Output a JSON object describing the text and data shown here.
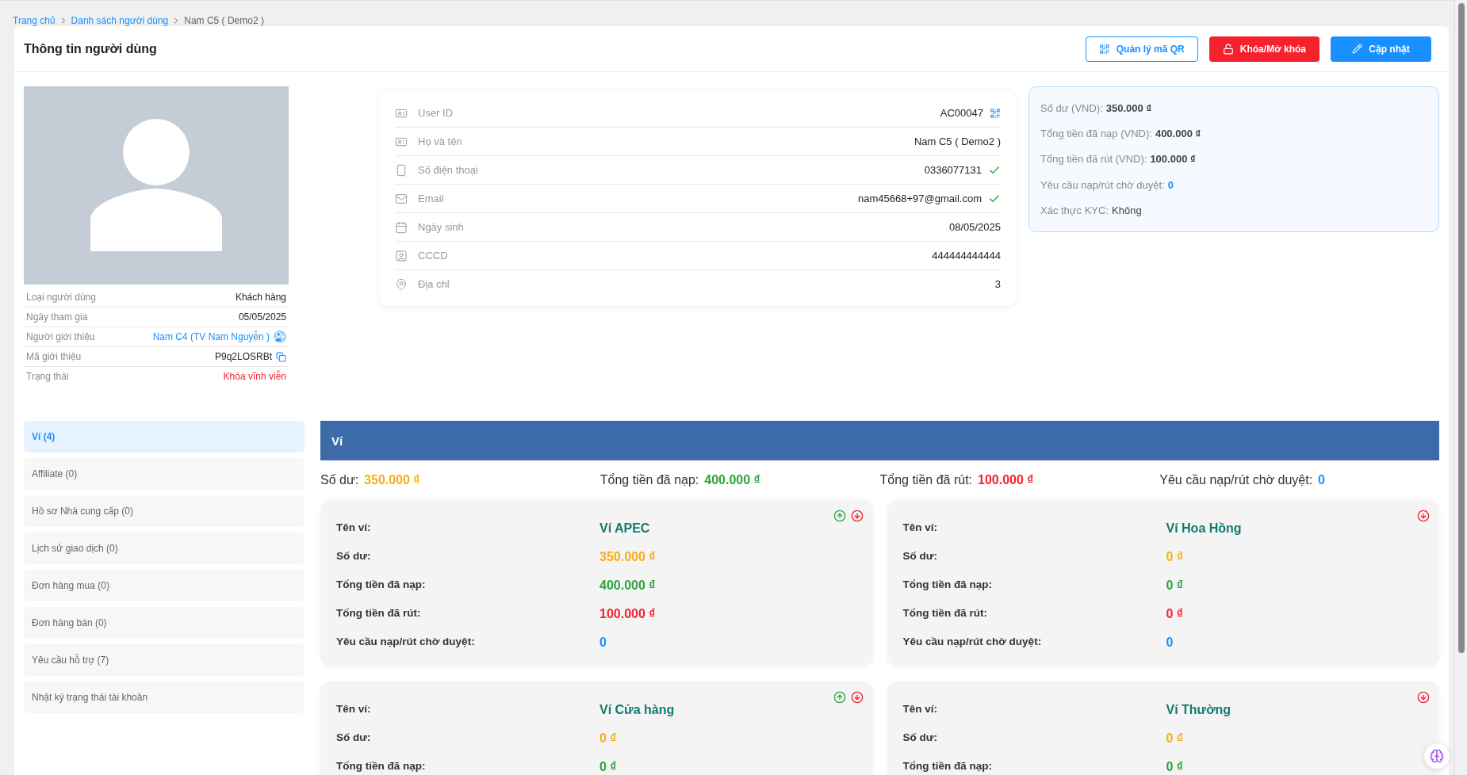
{
  "breadcrumb": [
    {
      "label": "Trang chủ",
      "current": false
    },
    {
      "label": "Danh sách người dùng",
      "current": false
    },
    {
      "label": "Nam C5 ( Demo2 )",
      "current": true
    }
  ],
  "header": {
    "title": "Thông tin người dùng",
    "buttons": [
      {
        "kind": "qr",
        "label": "Quản lý mã QR"
      },
      {
        "kind": "lock",
        "label": "Khóa/Mở khóa"
      },
      {
        "kind": "edit",
        "label": "Cập nhật"
      }
    ]
  },
  "profile": {
    "avatar": {
      "kind": "placeholder"
    },
    "rows": [
      {
        "label": "Loại người dùng",
        "value": "Khách hàng",
        "kind": "plain"
      },
      {
        "label": "Ngày tham gia",
        "value": "05/05/2025",
        "kind": "plain"
      },
      {
        "label": "Người giới thiệu",
        "value": "Nam C4 (TV Nam Nguyễn )",
        "kind": "link"
      },
      {
        "label": "Mã giới thiệu",
        "value": "P9q2LOSRBt",
        "kind": "code"
      },
      {
        "label": "Trạng thái",
        "value": "Khóa vĩnh viễn",
        "kind": "status"
      }
    ]
  },
  "details": [
    {
      "kind": "id",
      "label": "User ID",
      "value": "AC00047",
      "verified": false,
      "qr_code": true
    },
    {
      "kind": "id",
      "label": "Họ và tên",
      "value": "Nam C5 ( Demo2 )",
      "verified": false,
      "qr_code": false
    },
    {
      "kind": "phone",
      "label": "Số điện thoại",
      "value": "0336077131",
      "verified": true,
      "qr_code": false
    },
    {
      "kind": "mail",
      "label": "Email",
      "value": "nam45668+97@gmail.com",
      "verified": true,
      "qr_code": false
    },
    {
      "kind": "calendar",
      "label": "Ngày sinh",
      "value": "08/05/2025",
      "verified": false,
      "qr_code": false
    },
    {
      "kind": "card",
      "label": "CCCD",
      "value": "444444444444",
      "verified": false,
      "qr_code": false
    },
    {
      "kind": "pin",
      "label": "Địa chỉ",
      "value": "3",
      "verified": false,
      "qr_code": false
    }
  ],
  "summary": [
    {
      "label": "Số dư (VND):",
      "value": "350.000 ₫",
      "kind": "amount"
    },
    {
      "label": "Tổng tiền đã nạp (VND):",
      "value": "400.000 ₫",
      "kind": "amount"
    },
    {
      "label": "Tổng tiền đã rút (VND):",
      "value": "100.000 ₫",
      "kind": "amount"
    },
    {
      "label": "Yêu cầu nạp/rút chờ duyệt:",
      "value": "0",
      "kind": "count"
    },
    {
      "label": "Xác thực KYC:",
      "value": "Không",
      "kind": "text"
    }
  ],
  "tabs": [
    {
      "label": "Ví (4)",
      "selected": true
    },
    {
      "label": "Affiliate (0)",
      "selected": false
    },
    {
      "label": "Hồ sơ Nhà cung cấp (0)",
      "selected": false
    },
    {
      "label": "Lịch sử giao dịch (0)",
      "selected": false
    },
    {
      "label": "Đơn hàng mua (0)",
      "selected": false
    },
    {
      "label": "Đơn hàng bán (0)",
      "selected": false
    },
    {
      "label": "Yêu cầu hỗ trợ (7)",
      "selected": false
    },
    {
      "label": "Nhật ký trạng thái tài khoản",
      "selected": false
    }
  ],
  "wallet": {
    "title": "Ví",
    "totals": [
      {
        "label": "Số dư:",
        "value": "350.000 ₫",
        "kind": "balance"
      },
      {
        "label": "Tổng tiền đã nạp:",
        "value": "400.000 ₫",
        "kind": "deposit"
      },
      {
        "label": "Tổng tiền đã rút:",
        "value": "100.000 ₫",
        "kind": "withdraw"
      },
      {
        "label": "Yêu cầu nạp/rút chờ duyệt:",
        "value": "0",
        "kind": "pending"
      }
    ],
    "cards": [
      {
        "actions": [
          {
            "kind": "deposit"
          },
          {
            "kind": "withdraw"
          }
        ],
        "rows": [
          {
            "label": "Tên ví:",
            "value": "Ví APEC",
            "kind": "name"
          },
          {
            "label": "Số dư:",
            "value": "350.000 ₫",
            "kind": "balance"
          },
          {
            "label": "Tổng tiền đã nạp:",
            "value": "400.000 ₫",
            "kind": "deposit"
          },
          {
            "label": "Tổng tiền đã rút:",
            "value": "100.000 ₫",
            "kind": "withdraw"
          },
          {
            "label": "Yêu cầu nạp/rút chờ duyệt:",
            "value": "0",
            "kind": "pending"
          }
        ]
      },
      {
        "actions": [
          {
            "kind": "withdraw"
          }
        ],
        "rows": [
          {
            "label": "Tên ví:",
            "value": "Ví Hoa Hồng",
            "kind": "name"
          },
          {
            "label": "Số dư:",
            "value": "0 ₫",
            "kind": "balance"
          },
          {
            "label": "Tổng tiền đã nạp:",
            "value": "0 ₫",
            "kind": "deposit"
          },
          {
            "label": "Tổng tiền đã rút:",
            "value": "0 ₫",
            "kind": "withdraw"
          },
          {
            "label": "Yêu cầu nạp/rút chờ duyệt:",
            "value": "0",
            "kind": "pending"
          }
        ]
      },
      {
        "actions": [
          {
            "kind": "deposit"
          },
          {
            "kind": "withdraw"
          }
        ],
        "rows": [
          {
            "label": "Tên ví:",
            "value": "Ví Cửa hàng",
            "kind": "name"
          },
          {
            "label": "Số dư:",
            "value": "0 ₫",
            "kind": "balance"
          },
          {
            "label": "Tổng tiền đã nạp:",
            "value": "0 ₫",
            "kind": "deposit"
          }
        ]
      },
      {
        "actions": [
          {
            "kind": "withdraw"
          }
        ],
        "rows": [
          {
            "label": "Tên ví:",
            "value": "Ví Thường",
            "kind": "name"
          },
          {
            "label": "Số dư:",
            "value": "0 ₫",
            "kind": "balance"
          },
          {
            "label": "Tổng tiền đã nạp:",
            "value": "0 ₫",
            "kind": "deposit"
          }
        ]
      }
    ]
  }
}
